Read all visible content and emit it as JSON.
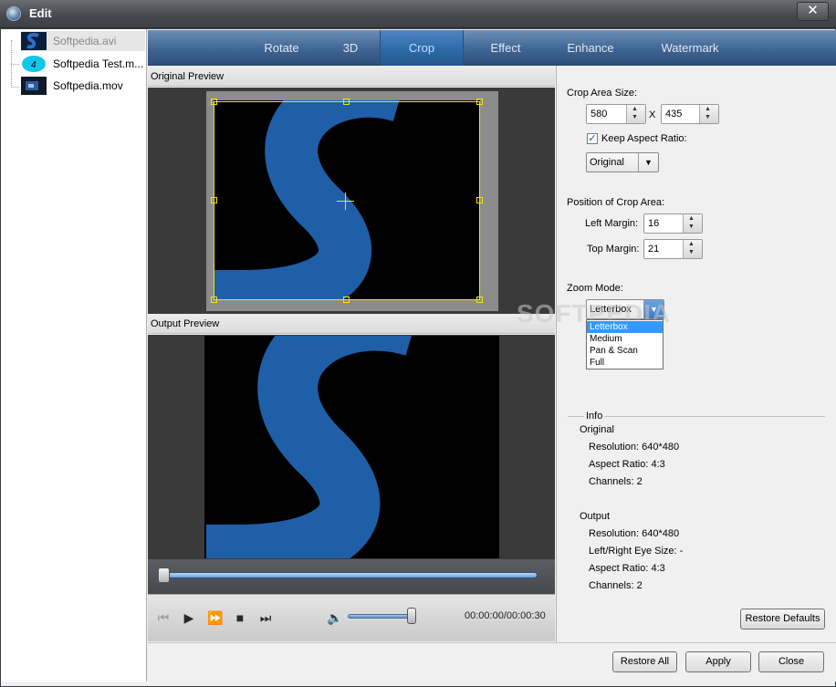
{
  "window": {
    "title": "Edit",
    "close_label": "✕"
  },
  "files": [
    {
      "name": "Softpedia.avi",
      "selected": true
    },
    {
      "name": "Softpedia Test.m...",
      "selected": false
    },
    {
      "name": "Softpedia.mov",
      "selected": false
    }
  ],
  "tabs": [
    "Rotate",
    "3D",
    "Crop",
    "Effect",
    "Enhance",
    "Watermark"
  ],
  "active_tab": "Crop",
  "preview": {
    "original_label": "Original Preview",
    "output_label": "Output Preview",
    "time": "00:00:00/00:00:30"
  },
  "crop": {
    "size_label": "Crop Area Size:",
    "width": "580",
    "x_sep": "X",
    "height": "435",
    "keep_aspect_label": "Keep Aspect Ratio:",
    "keep_aspect_checked": true,
    "aspect_value": "Original",
    "position_label": "Position of Crop Area:",
    "left_margin_label": "Left Margin:",
    "left_margin": "16",
    "top_margin_label": "Top Margin:",
    "top_margin": "21",
    "zoom_label": "Zoom Mode:",
    "zoom_value": "Letterbox",
    "zoom_options": [
      "Letterbox",
      "Medium",
      "Pan & Scan",
      "Full"
    ]
  },
  "info": {
    "title": "Info",
    "original_title": "Original",
    "original_resolution": "Resolution: 640*480",
    "original_aspect": "Aspect Ratio: 4:3",
    "original_channels": "Channels: 2",
    "output_title": "Output",
    "output_resolution": "Resolution: 640*480",
    "output_eye": "Left/Right Eye Size: -",
    "output_aspect": "Aspect Ratio: 4:3",
    "output_channels": "Channels: 2"
  },
  "buttons": {
    "restore_defaults": "Restore Defaults",
    "restore_all": "Restore All",
    "apply": "Apply",
    "close": "Close"
  },
  "watermark_text": "SOFTPEDIA",
  "colors": {
    "accent": "#2d6aa8",
    "crop_frame": "#f2e600",
    "logo_blue": "#1f5fa8"
  }
}
